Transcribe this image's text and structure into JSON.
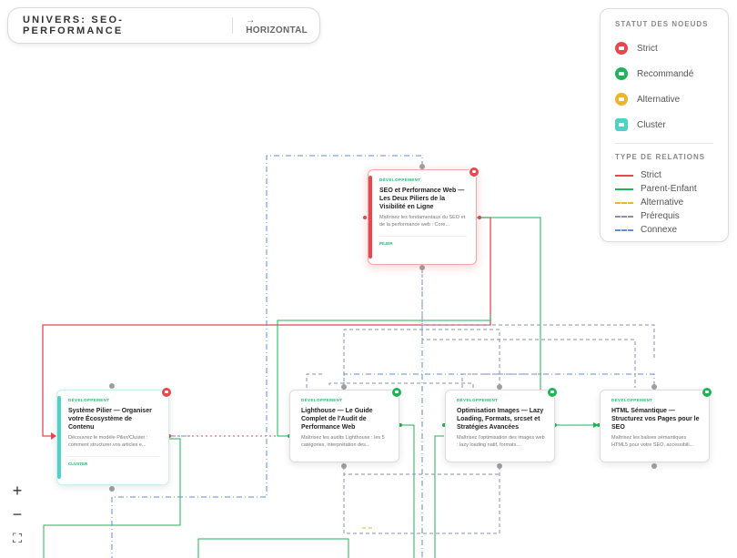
{
  "universe": {
    "title": "UNIVERS: SEO-PERFORMANCE",
    "orientation": "→ HORIZONTAL"
  },
  "legend": {
    "status_title": "STATUT DES NOEUDS",
    "statuses": [
      {
        "label": "Strict",
        "color": "#e5484d"
      },
      {
        "label": "Recommandé",
        "color": "#22b35a"
      },
      {
        "label": "Alternative",
        "color": "#f0b429"
      },
      {
        "label": "Cluster",
        "color": "#4fd1c5"
      }
    ],
    "relations_title": "TYPE DE RELATIONS",
    "relations": [
      {
        "label": "Strict",
        "color": "#e5484d",
        "style": "solid"
      },
      {
        "label": "Parent-Enfant",
        "color": "#22b35a",
        "style": "solid"
      },
      {
        "label": "Alternative",
        "color": "#f0b429",
        "style": "dashed"
      },
      {
        "label": "Prérequis",
        "color": "#8a8fb0",
        "style": "dashed"
      },
      {
        "label": "Connexe",
        "color": "#5b8fd6",
        "style": "dashdot"
      }
    ]
  },
  "nodes": {
    "seo": {
      "level": "DÉVELOPPEMENT",
      "title": "SEO et Performance Web — Les Deux Piliers de la Visibilité en Ligne",
      "desc": "Maîtrisez les fondamentaux du SEO et de la performance web : Core...",
      "category": "PILIER"
    },
    "pilier": {
      "level": "DÉVELOPPEMENT",
      "title": "Système Pilier — Organiser votre Écosystème de Contenu",
      "desc": "Découvrez le modèle Pilier/Cluster : comment structurer vos articles e...",
      "category": "CLUSTER"
    },
    "lighthouse": {
      "level": "DÉVELOPPEMENT",
      "title": "Lighthouse — Le Guide Complet de l'Audit de Performance Web",
      "desc": "Maîtrisez les audits Lighthouse : les 5 catégories, interprétation des..."
    },
    "images": {
      "level": "DÉVELOPPEMENT",
      "title": "Optimisation Images — Lazy Loading, Formats, srcset et Stratégies Avancées",
      "desc": "Maîtrisez l'optimisation des images web : lazy loading natif, formats..."
    },
    "html": {
      "level": "DÉVELOPPEMENT",
      "title": "HTML Sémantique — Structurez vos Pages pour le SEO",
      "desc": "Maîtrisez les balises sémantiques HTML5 pour votre SEO, accessibili..."
    }
  },
  "zoom": {
    "in": "+",
    "out": "−",
    "fit": "⛶"
  }
}
